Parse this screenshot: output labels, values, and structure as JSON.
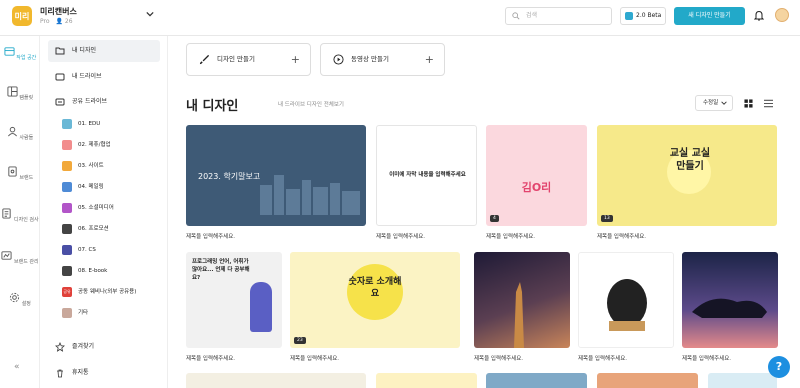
{
  "header": {
    "logo_text": "미리",
    "team_name": "미리캔버스",
    "plan": "Pro",
    "member_count": "26",
    "search_placeholder": "검색",
    "beta_label": "2.0 Beta",
    "new_design_label": "새 디자인 만들기"
  },
  "rail": {
    "items": [
      {
        "label": "작업 공간",
        "icon": "workspace-icon"
      },
      {
        "label": "템플릿",
        "icon": "template-icon"
      },
      {
        "label": "사람들",
        "icon": "people-icon"
      },
      {
        "label": "브랜드",
        "icon": "brand-icon"
      },
      {
        "label": "디자인 검사",
        "icon": "design-check-icon"
      },
      {
        "label": "브랜드 관리",
        "icon": "brand-manage-icon"
      },
      {
        "label": "설정",
        "icon": "gear-icon"
      }
    ],
    "collapse_label": "«"
  },
  "sidebar": {
    "my_design": "내 디자인",
    "my_drive": "내 드라이브",
    "shared_drive": "공유 드라이브",
    "folders": [
      {
        "label": "01. EDU",
        "color": "#6ab8d6",
        "tag": ""
      },
      {
        "label": "02. 제휴/협업",
        "color": "#f28d8d",
        "tag": ""
      },
      {
        "label": "03. 사이트",
        "color": "#f2a93b",
        "tag": ""
      },
      {
        "label": "04. 메일링",
        "color": "#4e8bd6",
        "tag": ""
      },
      {
        "label": "05. 소셜미디어",
        "color": "#b255c8",
        "tag": ""
      },
      {
        "label": "06. 프로모션",
        "color": "#444444",
        "tag": ""
      },
      {
        "label": "07. CS",
        "color": "#4a4fa5",
        "tag": ""
      },
      {
        "label": "08. E-book",
        "color": "#444444",
        "tag": ""
      },
      {
        "label": "공동 웨비나(외부 공유용)",
        "color": "#e0413a",
        "tag": "공유"
      },
      {
        "label": "기타",
        "color": "#c9a89b",
        "tag": ""
      }
    ],
    "favorites": "즐겨찾기",
    "trash": "휴지통"
  },
  "main": {
    "create_design": "디자인 만들기",
    "create_video": "동영상 만들기",
    "title": "내 디자인",
    "subtitle": "내 드라이브 디자인 전체보기",
    "sort_label": "수정일",
    "cards": [
      {
        "title": "제목을 입력해주세요.",
        "badge": "",
        "thumb_text": "2023. 학기말보고",
        "bg": "#3e5a76"
      },
      {
        "title": "제목을 입력해주세요.",
        "badge": "",
        "thumb_text": "이미에 자막 내용을 입력해주세요",
        "bg": "#ffffff"
      },
      {
        "title": "제목을 입력해주세요.",
        "badge": "4",
        "thumb_text": "김O리",
        "bg": "#fbd8de"
      },
      {
        "title": "제목을 입력해주세요.",
        "badge": "13",
        "thumb_text": "교실 교실 만들기",
        "bg": "#f6e98a"
      },
      {
        "title": "제목을 입력해주세요.",
        "badge": "",
        "thumb_text": "프로그래밍 언어, 어휘가 많아요... 언제 다 공부해요?",
        "bg": "#f1f1f1"
      },
      {
        "title": "제목을 입력해주세요.",
        "badge": "23",
        "thumb_text": "숫자로 소개해요",
        "bg": "#fbf3c4"
      },
      {
        "title": "제목을 입력해주세요.",
        "badge": "",
        "thumb_text": "",
        "bg": "#3a2b4a"
      },
      {
        "title": "제목을 입력해주세요.",
        "badge": "",
        "thumb_text": "",
        "bg": "#ffffff"
      },
      {
        "title": "제목을 입력해주세요.",
        "badge": "",
        "thumb_text": "",
        "bg": "#1c2447"
      }
    ]
  },
  "help_label": "?"
}
